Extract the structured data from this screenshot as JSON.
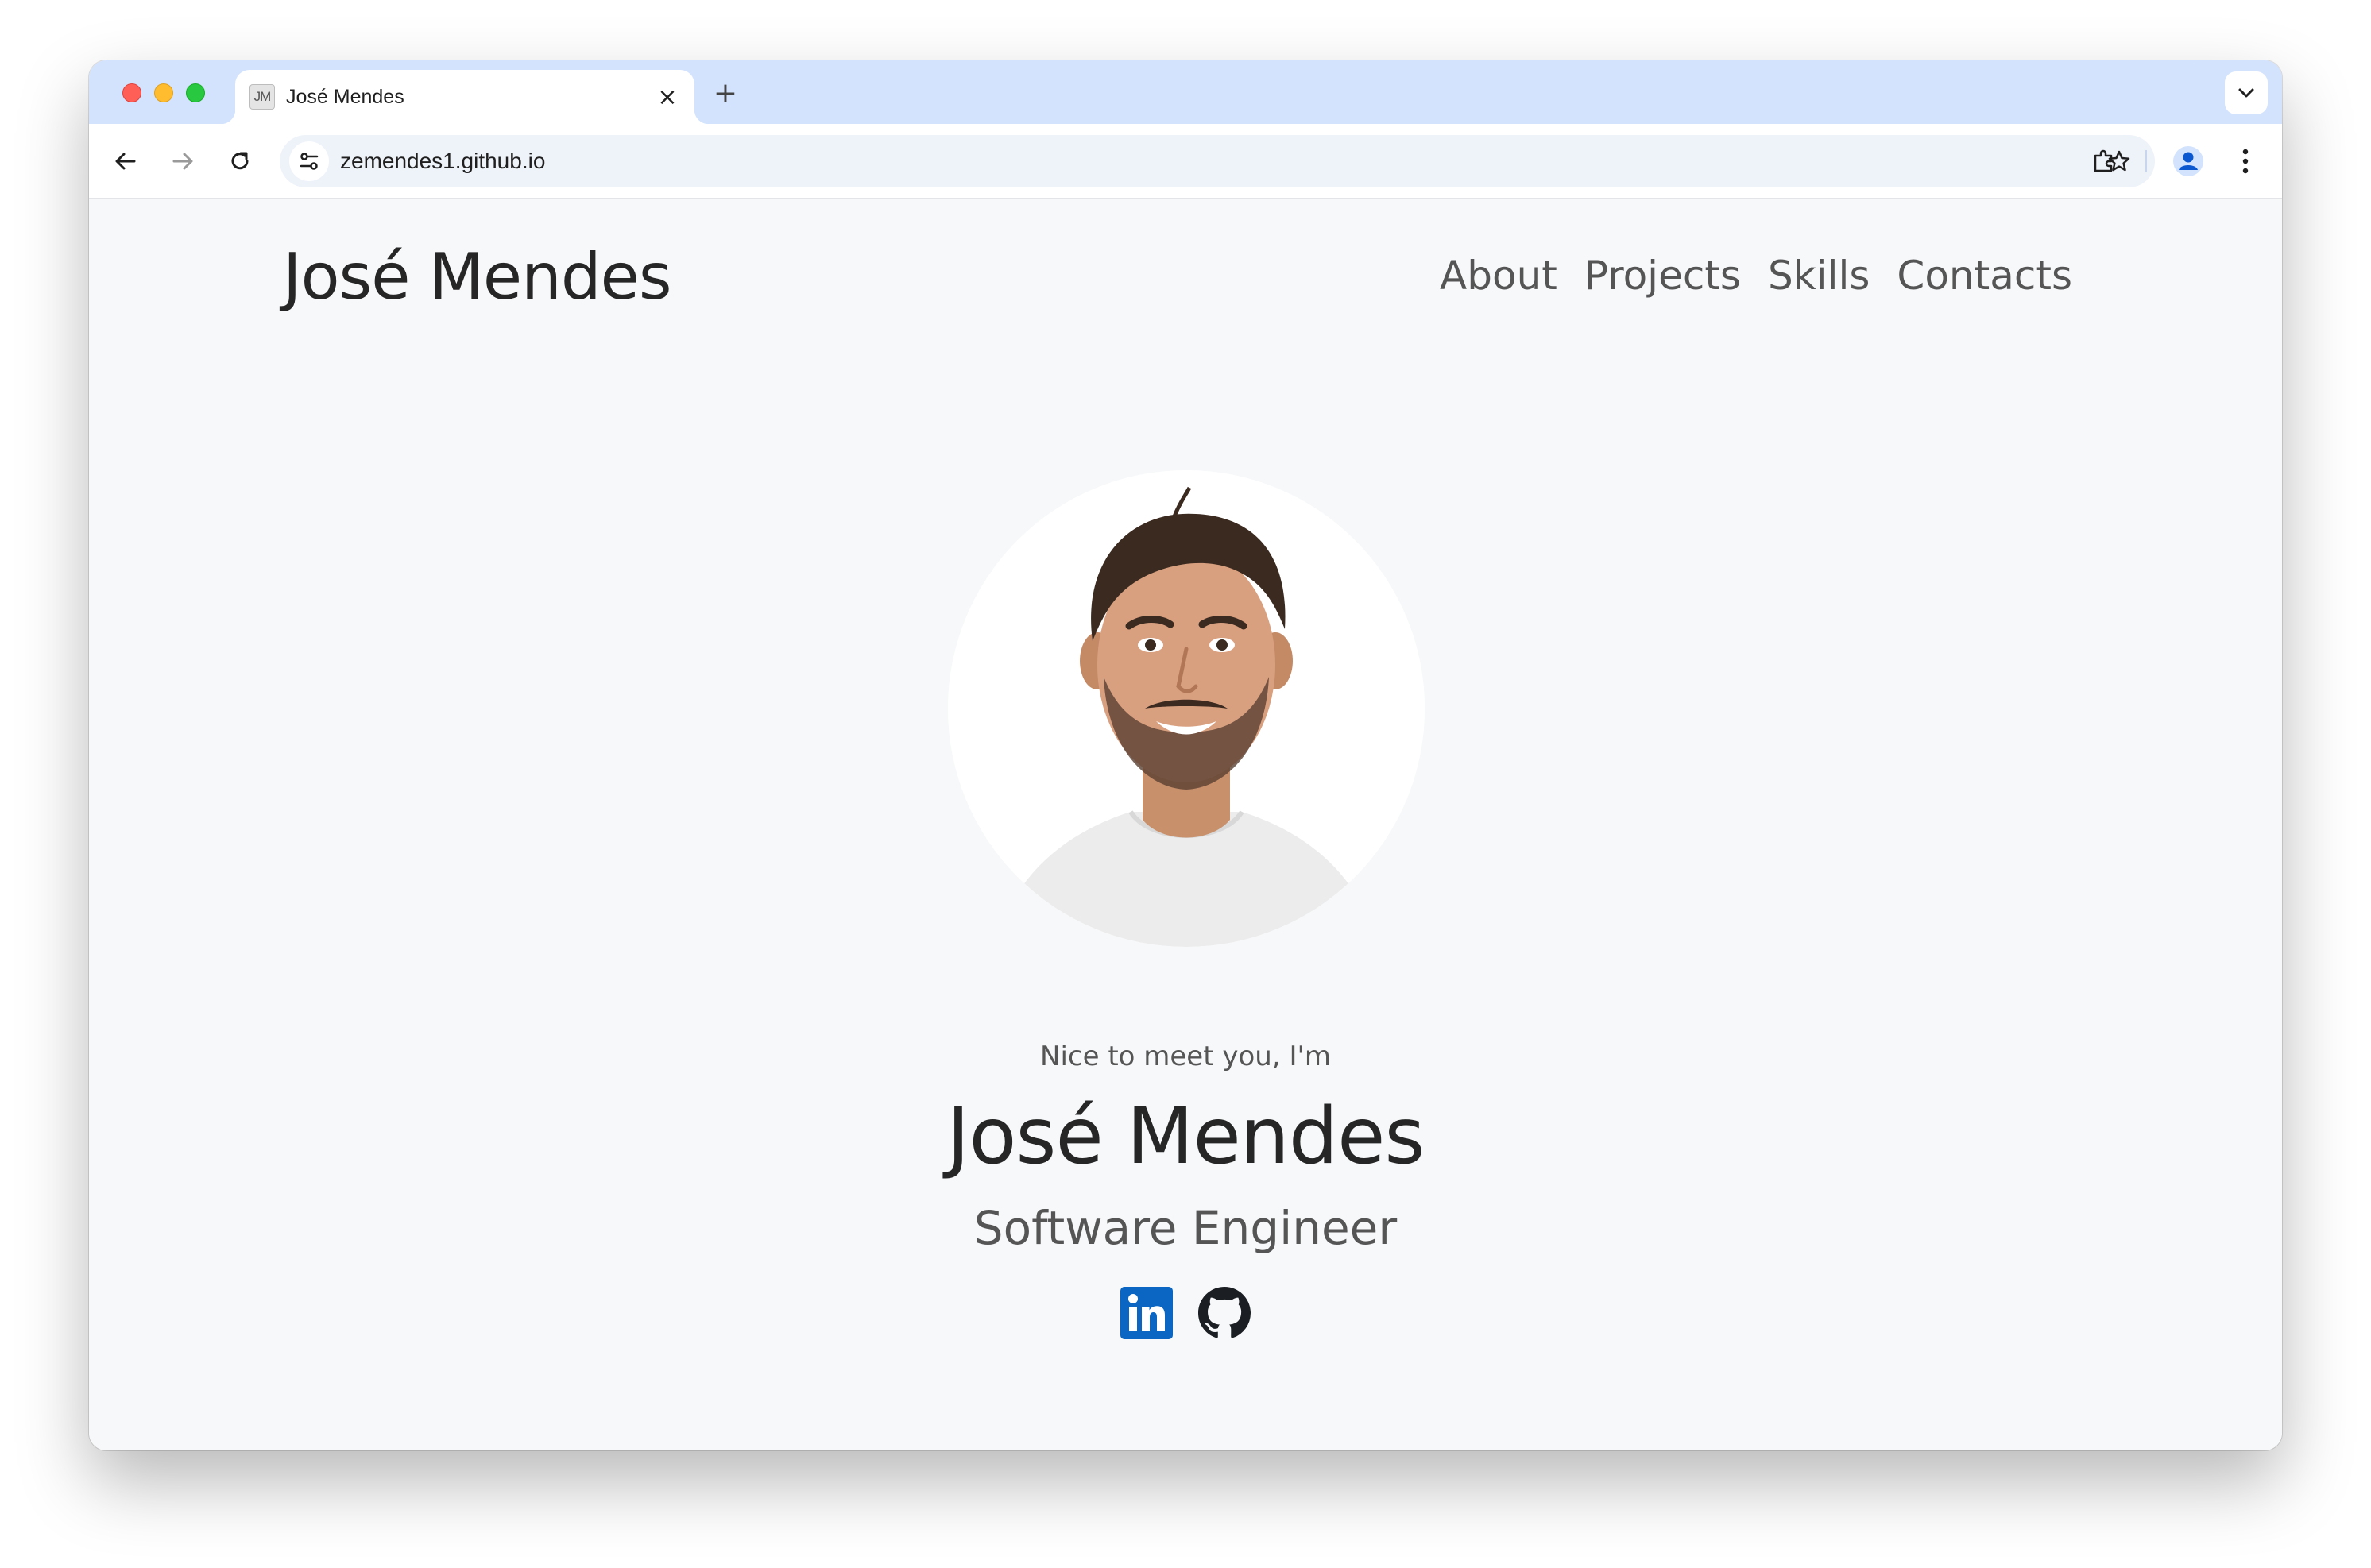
{
  "browser": {
    "tab": {
      "favicon_text": "JM",
      "title": "José Mendes",
      "close_glyph": "×"
    },
    "new_tab_glyph": "+",
    "address_bar": {
      "url": "zemendes1.github.io"
    }
  },
  "site": {
    "brand": "José Mendes",
    "nav": [
      "About",
      "Projects",
      "Skills",
      "Contacts"
    ]
  },
  "hero": {
    "greeting": "Nice to meet you, I'm",
    "name": "José Mendes",
    "role": "Software Engineer",
    "socials": [
      {
        "name": "linkedin-icon",
        "label": "in",
        "color": "#0a66c2"
      },
      {
        "name": "github-icon",
        "color": "#1b1f23"
      }
    ]
  },
  "colors": {
    "tabstrip": "#d3e3fd",
    "page_background": "#f7f8fa",
    "heading": "#262626",
    "muted_text": "#555555"
  }
}
